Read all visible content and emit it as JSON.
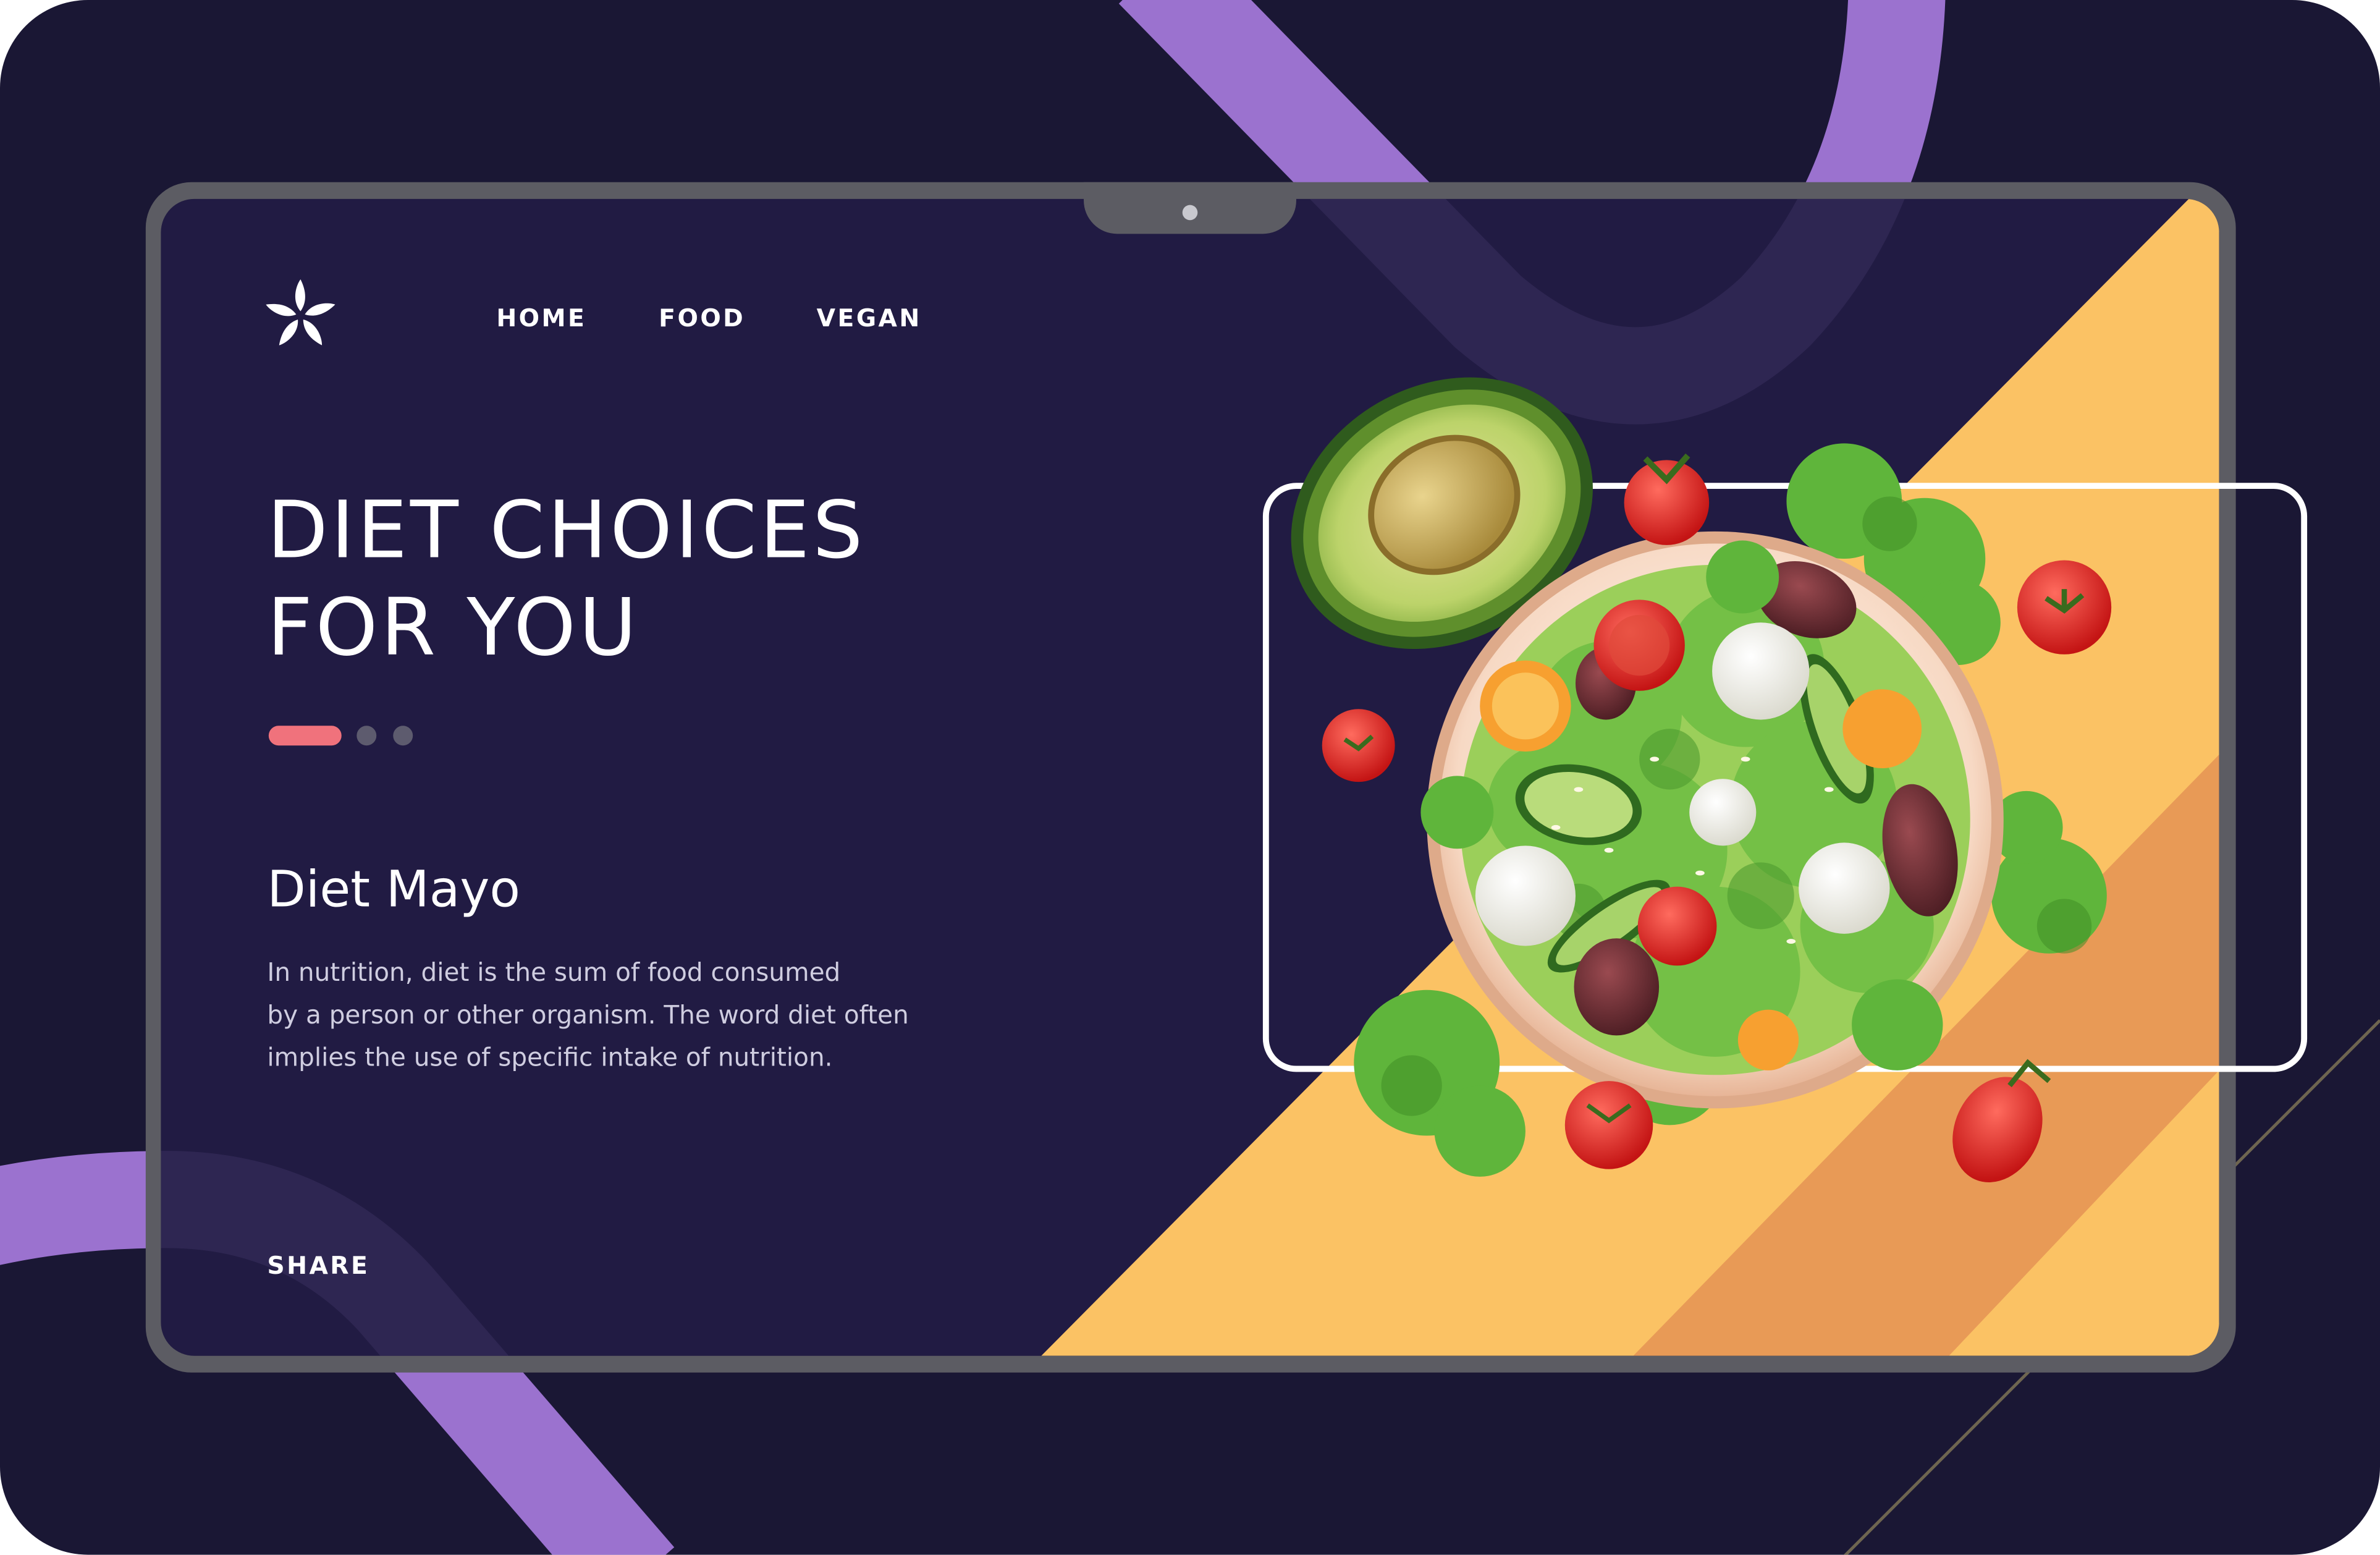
{
  "nav": {
    "items": [
      {
        "label": "HOME"
      },
      {
        "label": "FOOD"
      },
      {
        "label": "VEGAN"
      }
    ]
  },
  "hero": {
    "title_lines": [
      "DIET CHOICES",
      "FOR YOU"
    ],
    "carousel": {
      "slides": 3,
      "active_index": 1
    }
  },
  "content": {
    "subtitle": "Diet Mayo",
    "body_lines": [
      "In nutrition, diet is the sum of food consumed",
      "by a person or other organism. The word diet often",
      "implies the use of specific intake of nutrition."
    ]
  },
  "footer": {
    "share_label": "SHARE"
  },
  "icons": {
    "logo": "flower-logo-icon"
  },
  "colors": {
    "background": "#1a1734",
    "screen": "#211b43",
    "accent_purple": "#9b72cf",
    "accent_yellow": "#fbc264",
    "accent_orange": "#e89a56",
    "carousel_active": "#f0727c",
    "carousel_inactive": "#5d5b6e",
    "frame": "#5c5c63"
  }
}
